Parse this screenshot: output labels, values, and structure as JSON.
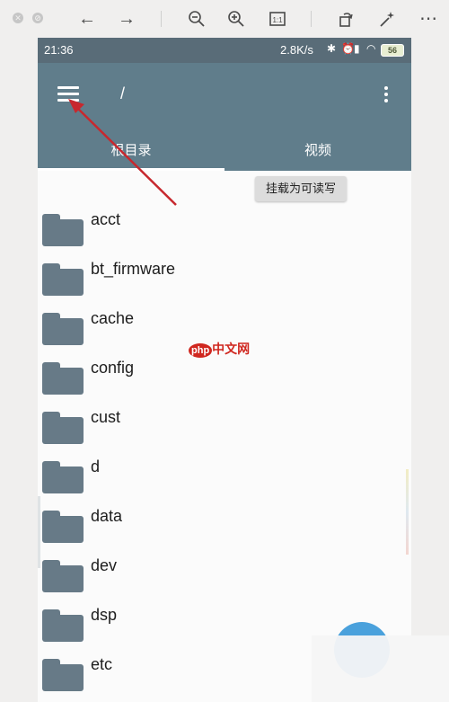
{
  "viewer": {
    "icons": [
      "close-icon",
      "disable-icon",
      "back-arrow-icon",
      "forward-arrow-icon",
      "zoom-out-icon",
      "zoom-in-icon",
      "fit-icon",
      "rotate-icon",
      "magic-wand-icon",
      "more-icon"
    ]
  },
  "status_bar": {
    "time": "21:36",
    "network_speed": "2.8K/s",
    "battery": "56"
  },
  "app_bar": {
    "path": "/",
    "tabs": [
      {
        "label": "根目录"
      },
      {
        "label": "视频"
      }
    ]
  },
  "mount_button_label": "挂载为可读写",
  "folders": [
    {
      "name": "acct"
    },
    {
      "name": "bt_firmware"
    },
    {
      "name": "cache"
    },
    {
      "name": "config"
    },
    {
      "name": "cust"
    },
    {
      "name": "d"
    },
    {
      "name": "data"
    },
    {
      "name": "dev"
    },
    {
      "name": "dsp"
    },
    {
      "name": "etc"
    }
  ],
  "watermark": {
    "badge": "php",
    "text": "中文网"
  },
  "colors": {
    "status_bar": "#596c78",
    "app_bar": "#607d8b",
    "folder_icon": "#677a87",
    "fab": "#4aa1dc",
    "annotation_arrow": "#c7282e"
  }
}
